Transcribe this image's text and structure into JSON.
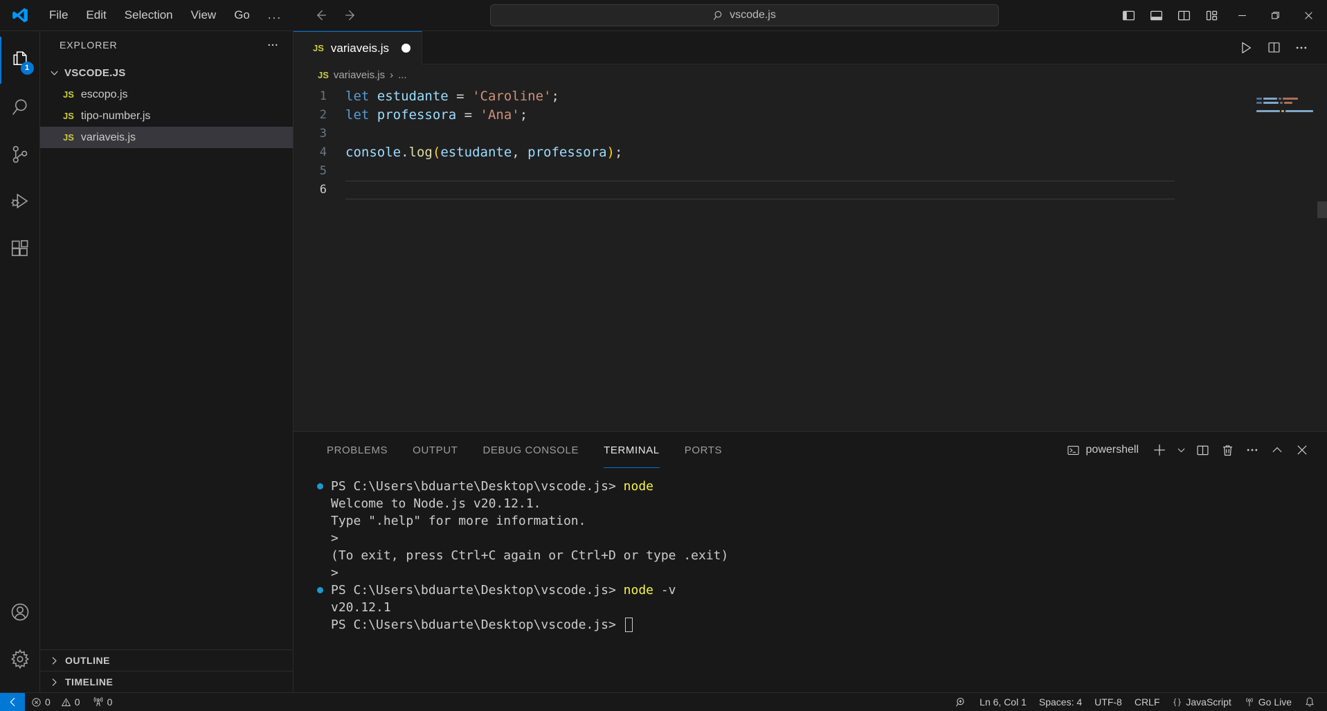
{
  "titlebar": {
    "logo_icon": "vscode-logo-icon",
    "menu": [
      "File",
      "Edit",
      "Selection",
      "View",
      "Go",
      "..."
    ],
    "nav": {
      "back_icon": "arrow-left-icon",
      "forward_icon": "arrow-right-icon"
    },
    "search": {
      "icon": "search-icon",
      "value": "vscode.js"
    },
    "layout_buttons": [
      {
        "name": "toggle-primary-sidebar",
        "icon": "layout-sidebar-left-icon"
      },
      {
        "name": "toggle-panel",
        "icon": "layout-panel-icon"
      },
      {
        "name": "toggle-secondary-sidebar",
        "icon": "layout-sidebar-right-icon"
      },
      {
        "name": "customize-layout",
        "icon": "layout-customize-icon"
      }
    ],
    "window_controls": [
      {
        "name": "minimize-button",
        "glyph": "—"
      },
      {
        "name": "maximize-button",
        "glyph": "❐"
      },
      {
        "name": "close-button",
        "glyph": "✕"
      }
    ]
  },
  "activitybar": {
    "items": [
      {
        "name": "explorer",
        "icon": "files-icon",
        "active": true,
        "badge": "1"
      },
      {
        "name": "search",
        "icon": "search-icon",
        "active": false,
        "badge": ""
      },
      {
        "name": "source-control",
        "icon": "source-control-icon",
        "active": false,
        "badge": ""
      },
      {
        "name": "run-and-debug",
        "icon": "run-debug-icon",
        "active": false,
        "badge": ""
      },
      {
        "name": "extensions",
        "icon": "extensions-icon",
        "active": false,
        "badge": ""
      }
    ],
    "bottom": [
      {
        "name": "accounts",
        "icon": "account-icon"
      },
      {
        "name": "manage-settings",
        "icon": "gear-icon"
      }
    ]
  },
  "sidebar": {
    "title": "EXPLORER",
    "more_actions_icon": "ellipsis-icon",
    "root": {
      "label": "VSCODE.JS",
      "expanded": true
    },
    "files": [
      {
        "name": "escopo.js",
        "badge": "JS",
        "selected": false
      },
      {
        "name": "tipo-number.js",
        "badge": "JS",
        "selected": false
      },
      {
        "name": "variaveis.js",
        "badge": "JS",
        "selected": true
      }
    ],
    "sections": [
      {
        "label": "OUTLINE",
        "expanded": false
      },
      {
        "label": "TIMELINE",
        "expanded": false
      }
    ]
  },
  "editor": {
    "tab": {
      "badge": "JS",
      "label": "variaveis.js",
      "dirty": true
    },
    "actions": [
      {
        "name": "run-code-button",
        "icon": "play-icon"
      },
      {
        "name": "split-editor-right-button",
        "icon": "split-editor-icon"
      },
      {
        "name": "more-actions-button",
        "icon": "ellipsis-icon"
      }
    ],
    "breadcrumb": {
      "badge": "JS",
      "file": "variaveis.js",
      "separator": "›",
      "more": "..."
    },
    "lines": [
      {
        "num": "1",
        "tokens": [
          {
            "t": "let",
            "c": "k-let"
          },
          {
            "t": " ",
            "c": "k-op"
          },
          {
            "t": "estudante",
            "c": "k-var"
          },
          {
            "t": " = ",
            "c": "k-op"
          },
          {
            "t": "'Caroline'",
            "c": "k-str"
          },
          {
            "t": ";",
            "c": "k-punc"
          }
        ]
      },
      {
        "num": "2",
        "tokens": [
          {
            "t": "let",
            "c": "k-let"
          },
          {
            "t": " ",
            "c": "k-op"
          },
          {
            "t": "professora",
            "c": "k-var"
          },
          {
            "t": " = ",
            "c": "k-op"
          },
          {
            "t": "'Ana'",
            "c": "k-str"
          },
          {
            "t": ";",
            "c": "k-punc"
          }
        ]
      },
      {
        "num": "3",
        "tokens": []
      },
      {
        "num": "4",
        "tokens": [
          {
            "t": "console",
            "c": "k-var"
          },
          {
            "t": ".",
            "c": "k-punc"
          },
          {
            "t": "log",
            "c": "k-fn"
          },
          {
            "t": "(",
            "c": "k-paren"
          },
          {
            "t": "estudante",
            "c": "k-var"
          },
          {
            "t": ", ",
            "c": "k-punc"
          },
          {
            "t": "professora",
            "c": "k-var"
          },
          {
            "t": ")",
            "c": "k-paren"
          },
          {
            "t": ";",
            "c": "k-punc"
          }
        ]
      },
      {
        "num": "5",
        "tokens": []
      },
      {
        "num": "6",
        "tokens": [],
        "active": true
      }
    ]
  },
  "panel": {
    "tabs": [
      {
        "label": "PROBLEMS",
        "active": false
      },
      {
        "label": "OUTPUT",
        "active": false
      },
      {
        "label": "DEBUG CONSOLE",
        "active": false
      },
      {
        "label": "TERMINAL",
        "active": true
      },
      {
        "label": "PORTS",
        "active": false
      }
    ],
    "terminal_name": "powershell",
    "terminal_icon": "terminal-powershell-icon",
    "actions": [
      {
        "name": "new-terminal-button",
        "icon": "plus-icon"
      },
      {
        "name": "terminal-profile-dropdown",
        "icon": "chevron-down-icon"
      },
      {
        "name": "split-terminal-button",
        "icon": "split-icon"
      },
      {
        "name": "kill-terminal-button",
        "icon": "trash-icon"
      },
      {
        "name": "terminal-more-actions-button",
        "icon": "ellipsis-icon"
      },
      {
        "name": "maximize-panel-button",
        "icon": "chevron-up-icon"
      },
      {
        "name": "close-panel-button",
        "icon": "close-icon"
      }
    ],
    "terminal_lines": [
      {
        "dot": true,
        "prompt": "PS C:\\Users\\bduarte\\Desktop\\vscode.js> ",
        "cmd": "node",
        "arg": "",
        "text": ""
      },
      {
        "dot": false,
        "prompt": "",
        "cmd": "",
        "arg": "",
        "text": "Welcome to Node.js v20.12.1."
      },
      {
        "dot": false,
        "prompt": "",
        "cmd": "",
        "arg": "",
        "text": "Type \".help\" for more information."
      },
      {
        "dot": false,
        "prompt": "",
        "cmd": "",
        "arg": "",
        "text": ">"
      },
      {
        "dot": false,
        "prompt": "",
        "cmd": "",
        "arg": "",
        "text": "(To exit, press Ctrl+C again or Ctrl+D or type .exit)"
      },
      {
        "dot": false,
        "prompt": "",
        "cmd": "",
        "arg": "",
        "text": ">"
      },
      {
        "dot": true,
        "prompt": "PS C:\\Users\\bduarte\\Desktop\\vscode.js> ",
        "cmd": "node",
        "arg": " -v",
        "text": ""
      },
      {
        "dot": false,
        "prompt": "",
        "cmd": "",
        "arg": "",
        "text": "v20.12.1"
      },
      {
        "dot": false,
        "prompt": "PS C:\\Users\\bduarte\\Desktop\\vscode.js> ",
        "cmd": "",
        "arg": "",
        "text": "",
        "cursor": true
      }
    ]
  },
  "statusbar": {
    "remote": {
      "icon": "remote-window-icon",
      "label": ""
    },
    "errors": {
      "icon": "error-icon",
      "count": "0"
    },
    "warnings": {
      "icon": "warning-icon",
      "count": "0"
    },
    "ports": {
      "icon": "radio-tower-icon",
      "count": "0"
    },
    "zoom_icon": "zoom-in-icon",
    "cursor_position": "Ln 6, Col 1",
    "indentation": "Spaces: 4",
    "encoding": "UTF-8",
    "eol": "CRLF",
    "language": "JavaScript",
    "language_icon": "braces-icon",
    "go_live": "Go Live",
    "go_live_icon": "broadcast-icon",
    "notifications_icon": "bell-icon"
  },
  "colors": {
    "accent": "#0078d4",
    "titlebar_bg": "#181818",
    "editor_bg": "#1f1f1f",
    "selection_bg": "#37373d"
  }
}
